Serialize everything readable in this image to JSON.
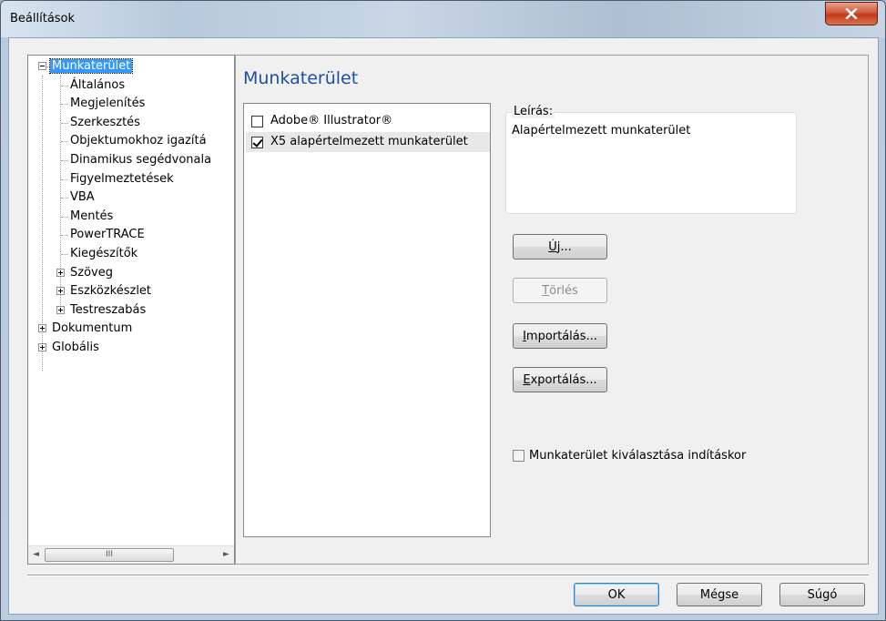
{
  "window": {
    "title": "Beállítások",
    "close_label": "x"
  },
  "tree": {
    "items": [
      {
        "label": "Munkaterület",
        "level": 0,
        "expander": "minus",
        "selected": true
      },
      {
        "label": "Általános",
        "level": 1
      },
      {
        "label": "Megjelenítés",
        "level": 1
      },
      {
        "label": "Szerkesztés",
        "level": 1
      },
      {
        "label": "Objektumokhoz igazítá",
        "level": 1
      },
      {
        "label": "Dinamikus segédvonala",
        "level": 1
      },
      {
        "label": "Figyelmeztetések",
        "level": 1
      },
      {
        "label": "VBA",
        "level": 1
      },
      {
        "label": "Mentés",
        "level": 1
      },
      {
        "label": "PowerTRACE",
        "level": 1
      },
      {
        "label": "Kiegészítők",
        "level": 1
      },
      {
        "label": "Szöveg",
        "level": 1,
        "expander": "plus"
      },
      {
        "label": "Eszközkészlet",
        "level": 1,
        "expander": "plus"
      },
      {
        "label": "Testreszabás",
        "level": 1,
        "expander": "plus"
      },
      {
        "label": "Dokumentum",
        "level": 0,
        "expander": "plus"
      },
      {
        "label": "Globális",
        "level": 0,
        "expander": "plus"
      }
    ],
    "scroll_left": "◄",
    "scroll_right": "►",
    "scroll_thumb": "III"
  },
  "main": {
    "title": "Munkaterület",
    "workspaces": [
      {
        "label": "Adobe® Illustrator®",
        "checked": false
      },
      {
        "label": "X5 alapértelmezett munkaterület",
        "checked": true
      }
    ],
    "description": {
      "legend": "Leírás:",
      "text": "Alapértelmezett munkaterület"
    },
    "buttons": {
      "new_prefix": "",
      "new_accel": "Ú",
      "new_rest": "j...",
      "delete_prefix": "",
      "delete_accel": "T",
      "delete_rest": "örlés",
      "import_prefix": "",
      "import_accel": "I",
      "import_rest": "mportálás...",
      "export_prefix": "",
      "export_accel": "E",
      "export_rest": "xportálás..."
    },
    "startup_checkbox": {
      "label": "Munkaterület kiválasztása indításkor",
      "checked": false
    }
  },
  "footer": {
    "ok": "OK",
    "cancel": "Mégse",
    "help": "Súgó"
  }
}
